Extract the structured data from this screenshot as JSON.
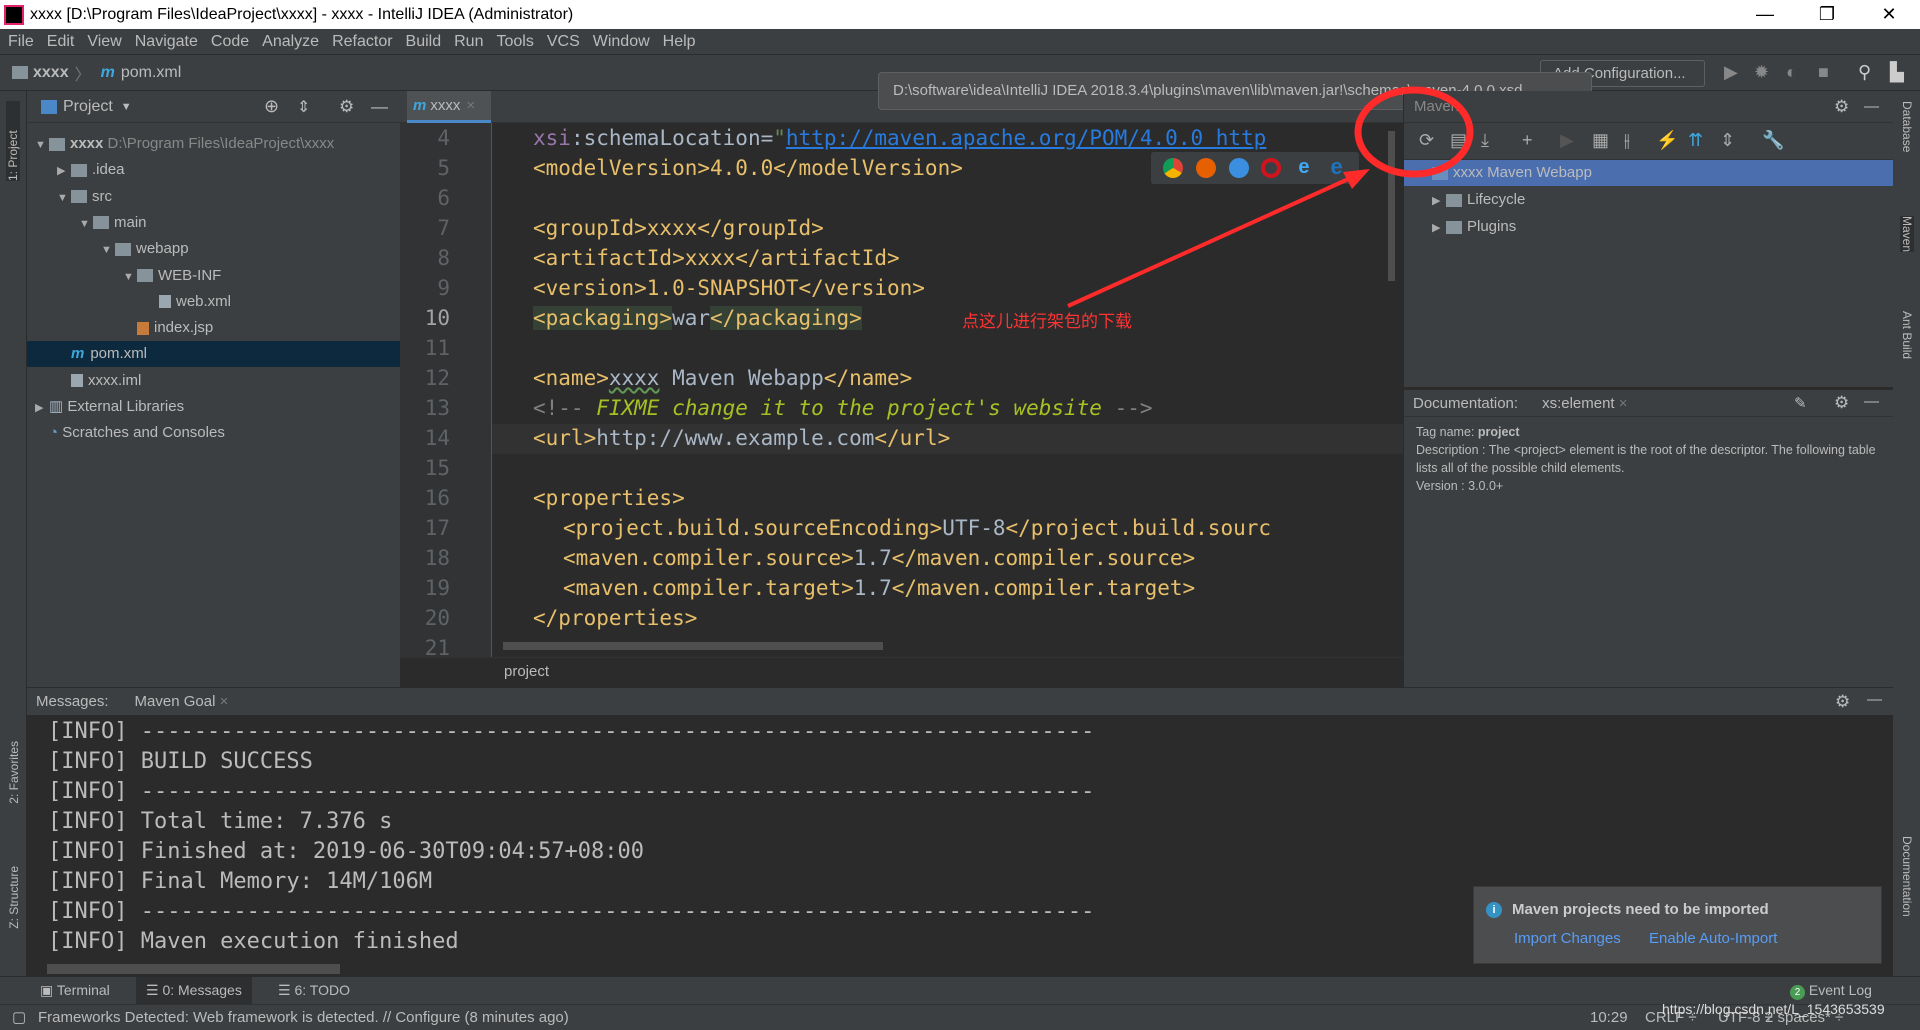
{
  "window": {
    "title": "xxxx [D:\\Program Files\\IdeaProject\\xxxx] - xxxx - IntelliJ IDEA (Administrator)",
    "minimize": "—",
    "maximize": "❐",
    "close": "✕"
  },
  "menu": [
    "File",
    "Edit",
    "View",
    "Navigate",
    "Code",
    "Analyze",
    "Refactor",
    "Build",
    "Run",
    "Tools",
    "VCS",
    "Window",
    "Help"
  ],
  "navbar": {
    "project": "xxxx",
    "file": "pom.xml",
    "run_config": "Add Configuration..."
  },
  "left_stripe": {
    "project": "1: Project",
    "favorites": "2: Favorites",
    "structure": "Z: Structure"
  },
  "right_stripe": {
    "database": "Database",
    "maven": "Maven",
    "ant": "Ant Build",
    "documentation": "Documentation"
  },
  "project_panel": {
    "title": "Project",
    "items": [
      {
        "label": "xxxx",
        "path": "D:\\Program Files\\IdeaProject\\xxxx",
        "depth": 0,
        "expanded": true
      },
      {
        "label": ".idea",
        "depth": 1,
        "expanded": false
      },
      {
        "label": "src",
        "depth": 1,
        "expanded": true
      },
      {
        "label": "main",
        "depth": 2,
        "expanded": true
      },
      {
        "label": "webapp",
        "depth": 3,
        "expanded": true
      },
      {
        "label": "WEB-INF",
        "depth": 4,
        "expanded": true
      },
      {
        "label": "web.xml",
        "depth": 5
      },
      {
        "label": "index.jsp",
        "depth": 4
      },
      {
        "label": "pom.xml",
        "depth": 1,
        "selected": true
      },
      {
        "label": "xxxx.iml",
        "depth": 1
      },
      {
        "label": "External Libraries",
        "depth": 0,
        "expanded": false
      },
      {
        "label": "Scratches and Consoles",
        "depth": 0
      }
    ]
  },
  "editor": {
    "tab": "xxxx",
    "breadcrumb": "project",
    "current_line": 10,
    "line_numbers": [
      "4",
      "5",
      "6",
      "7",
      "8",
      "9",
      "10",
      "11",
      "12",
      "13",
      "14",
      "15",
      "16",
      "17",
      "18",
      "19",
      "20",
      "21"
    ],
    "lines": {
      "l4a": "xsi",
      "l4b": ":schemaLocation=",
      "l4c": "\"",
      "l4d": "http://maven.apache.org/POM/4.0.0 http",
      "l5": "<modelVersion>4.0.0</modelVersion>",
      "l7": "<groupId>xxxx</groupId>",
      "l8": "<artifactId>xxxx</artifactId>",
      "l9": "<version>1.0-SNAPSHOT</version>",
      "l10a": "<packaging>",
      "l10b": "war",
      "l10c": "</packaging>",
      "l12a": "<name>",
      "l12b": "xxxx",
      "l12c": " Maven Webapp",
      "l12d": "</name>",
      "l13a": "<!-- ",
      "l13b": "FIXME change it to the project's website",
      "l13c": " -->",
      "l14a": "<url>",
      "l14b": "http://www.example.com",
      "l14c": "</url>",
      "l16": "<properties>",
      "l17a": "<project.build.sourceEncoding>",
      "l17b": "UTF-8",
      "l17c": "</project.build.sourc",
      "l18a": "<maven.compiler.source>",
      "l18b": "1.7",
      "l18c": "</maven.compiler.source>",
      "l19a": "<maven.compiler.target>",
      "l19b": "1.7",
      "l19c": "</maven.compiler.target>",
      "l20": "</properties>"
    },
    "annotation": "点这儿进行架包的下载",
    "tooltip": "D:\\software\\idea\\IntelliJ IDEA 2018.3.4\\plugins\\maven\\lib\\maven.jar!\\schemas\\maven-4.0.0.xsd",
    "annotation_color": "#ff3333"
  },
  "maven_panel": {
    "title": "Maven",
    "tree": [
      {
        "label": "xxxx Maven Webapp",
        "selected": true
      },
      {
        "label": "Lifecycle"
      },
      {
        "label": "Plugins"
      }
    ]
  },
  "documentation": {
    "label": "Documentation:",
    "tab": "xs:element",
    "tag_label": "Tag name: ",
    "tag_name": "project",
    "description": "Description : The <project> element is the root of the descriptor. The following table lists all of the possible child elements.",
    "version": "Version : 3.0.0+"
  },
  "messages": {
    "label": "Messages:",
    "tab": "Maven Goal",
    "lines": [
      "[INFO] ------------------------------------------------------------------------",
      "[INFO] BUILD SUCCESS",
      "[INFO] ------------------------------------------------------------------------",
      "[INFO] Total time: 7.376 s",
      "[INFO] Finished at: 2019-06-30T09:04:57+08:00",
      "[INFO] Final Memory: 14M/106M",
      "[INFO] ------------------------------------------------------------------------",
      "[INFO] Maven execution finished"
    ]
  },
  "notification": {
    "title": "Maven projects need to be imported",
    "import": "Import Changes",
    "auto_import": "Enable Auto-Import"
  },
  "tool_windows": {
    "terminal": "Terminal",
    "messages": "0: Messages",
    "todo": "6: TODO",
    "event_log": "Event Log",
    "event_count": "2"
  },
  "status": {
    "message": "Frameworks Detected: Web framework is detected. // Configure (8 minutes ago)",
    "position": "10:29",
    "line_sep": "CRLF ÷",
    "encoding": "UTF-8 ÷",
    "indent": "2 spaces* ÷",
    "watermark": "https://blog.csdn.net/L_1543653539"
  }
}
